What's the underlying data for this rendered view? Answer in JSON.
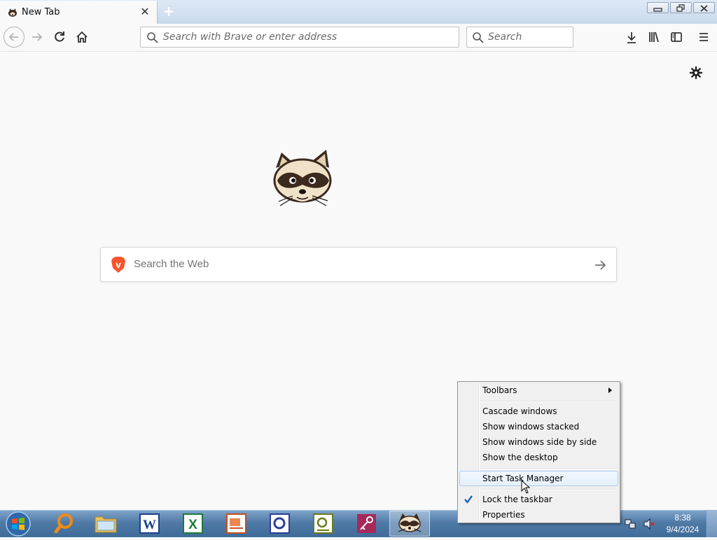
{
  "browser": {
    "tab": {
      "title": "New Tab",
      "close_glyph": "✕",
      "new_tab_glyph": "+"
    },
    "address": {
      "placeholder": "Search with Brave or enter address"
    },
    "search": {
      "placeholder": "Search"
    },
    "new_tab_page": {
      "search_placeholder": "Search the Web"
    }
  },
  "context_menu": {
    "items": [
      {
        "label": "Toolbars",
        "submenu": true
      },
      {
        "label": "Cascade windows"
      },
      {
        "label": "Show windows stacked"
      },
      {
        "label": "Show windows side by side"
      },
      {
        "label": "Show the desktop"
      },
      {
        "label": "Start Task Manager",
        "highlighted": true
      },
      {
        "label": "Lock the taskbar",
        "checked": true
      },
      {
        "label": "Properties"
      }
    ]
  },
  "taskbar": {
    "apps": [
      "start-orb",
      "search-app",
      "file-explorer",
      "word",
      "excel",
      "powerpoint",
      "app-5",
      "app-6",
      "app-7",
      "browser-app"
    ],
    "clock": {
      "time": "8:38",
      "date": "9/4/2024"
    }
  },
  "colors": {
    "accent_blue": "#0a58c7",
    "taskbar": "#4f7aa6",
    "brave_orange": "#fb542b"
  }
}
